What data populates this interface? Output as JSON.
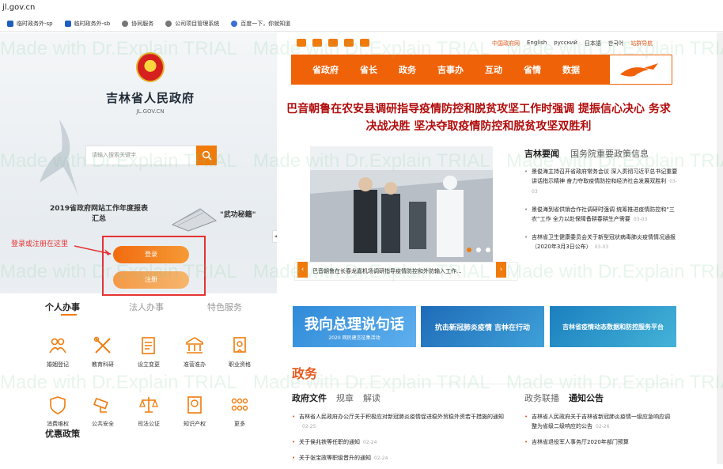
{
  "browser": {
    "url": "jl.gov.cn",
    "bookmarks": [
      "临时政务外-sp",
      "临时政务外-sb",
      "协同服务",
      "公司项目管理系统",
      "百度一下，你就知道"
    ]
  },
  "left": {
    "site_title": "吉林省人民政府",
    "site_domain": "JL.GOV.CN",
    "search_placeholder": "请输入搜索关键字",
    "report_title": "2019省政府网站工作年度报表汇总",
    "wugong_label": "\"武功秘籍\"",
    "annotation": "登录或注册在这里",
    "login_label": "登录",
    "register_label": "注册",
    "tabs": [
      "个人办事",
      "法人办事",
      "特色服务"
    ],
    "services": [
      {
        "label": "婚姻登记",
        "icon": "couple-icon"
      },
      {
        "label": "教育科研",
        "icon": "tools-icon"
      },
      {
        "label": "设立变更",
        "icon": "document-icon"
      },
      {
        "label": "准营准办",
        "icon": "license-icon"
      },
      {
        "label": "职业资格",
        "icon": "certificate-icon"
      },
      {
        "label": "消费维权",
        "icon": "shield-icon"
      },
      {
        "label": "公共安全",
        "icon": "camera-icon"
      },
      {
        "label": "司法公证",
        "icon": "scale-icon"
      },
      {
        "label": "知识产权",
        "icon": "ip-icon"
      },
      {
        "label": "更多",
        "icon": "more-icon"
      }
    ],
    "lower_title": "优惠政策"
  },
  "right": {
    "languages": [
      "中国政府网",
      "English",
      "русский",
      "日本語",
      "한국어",
      "站群导航"
    ],
    "nav": [
      "省政府",
      "省长",
      "政务",
      "吉事办",
      "互动",
      "省情",
      "数据"
    ],
    "headline": "巴音朝鲁在农安县调研指导疫情防控和脱贫攻坚工作时强调 提振信心决心 务求决战决胜 坚决夺取疫情防控和脱贫攻坚双胜利",
    "slide_caption": "巴音朝鲁在长春龙嘉机场调研指导疫情防控和外防输入工作...",
    "news_tab_active": "吉林要闻",
    "news_tab_other": "国务院重要政策信息",
    "news": [
      {
        "text": "景俊海主持召开省政府常务会议 深入贯彻习近平总书记重要讲话指示精神 奋力夺取疫情防控和经济社会发展双胜利",
        "date": "03-03"
      },
      {
        "text": "景俊海到省供销合作社调研时强调 统筹推进疫情防控和“三农”工作 全力以赴保障备耕春耕生产需要",
        "date": "03-03"
      },
      {
        "text": "吉林省卫生健康委员会关于新型冠状病毒肺炎疫情情况通报（2020年3月3日公布）",
        "date": "03-03"
      }
    ],
    "banners": [
      "我向总理说句话",
      "抗击新冠肺炎疫情 吉林在行动",
      "吉林省疫情动态数据和防控服务平台"
    ],
    "banner_sub": "2020 网民建言征集活动",
    "gov_head": "政务",
    "gov_tabs": [
      "政府文件",
      "规章",
      "解读"
    ],
    "gov_tabs2": [
      "政务联播",
      "通知公告"
    ],
    "docs": [
      {
        "text": "吉林省人民政府办公厅关于积极应对新冠肺炎疫情促进稳外贸稳外资若干措施的通知",
        "date": "02-25"
      },
      {
        "text": "关于侯兆铁等任职的通知",
        "date": "02-24"
      },
      {
        "text": "关于张宝政等职级晋升的通知",
        "date": "02-24"
      }
    ],
    "notices": [
      {
        "text": "吉林省人民政府关于吉林省新冠肺炎疫情一级应急响应调整为省级二级响应的公告",
        "date": "02-26"
      },
      {
        "text": "吉林省退役军人事务厅2020年部门预算",
        "date": ""
      }
    ]
  },
  "watermark": "Made with Dr.Explain TRIAL"
}
